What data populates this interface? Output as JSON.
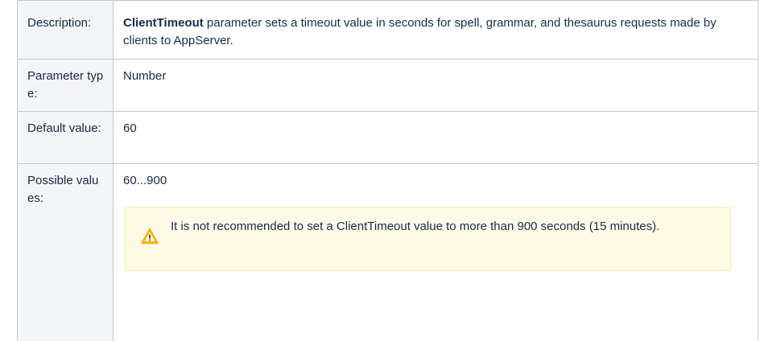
{
  "rows": [
    {
      "header": "Description:",
      "value_bold": "ClientTimeout",
      "value_rest": " parameter sets a timeout value in seconds for spell, grammar, and thesaurus requests made by clients to AppServer."
    },
    {
      "header": "Parameter type:",
      "value": "Number"
    },
    {
      "header": "Default value:",
      "value": "60"
    },
    {
      "header": "Possible values:",
      "value": "60...900"
    }
  ],
  "warning": {
    "icon": "warning-triangle-icon",
    "text": "It is not recommended to set a ClientTimeout value to more than 900 seconds (15 minutes).",
    "accent": "#ffab00",
    "background": "#fffae6"
  }
}
